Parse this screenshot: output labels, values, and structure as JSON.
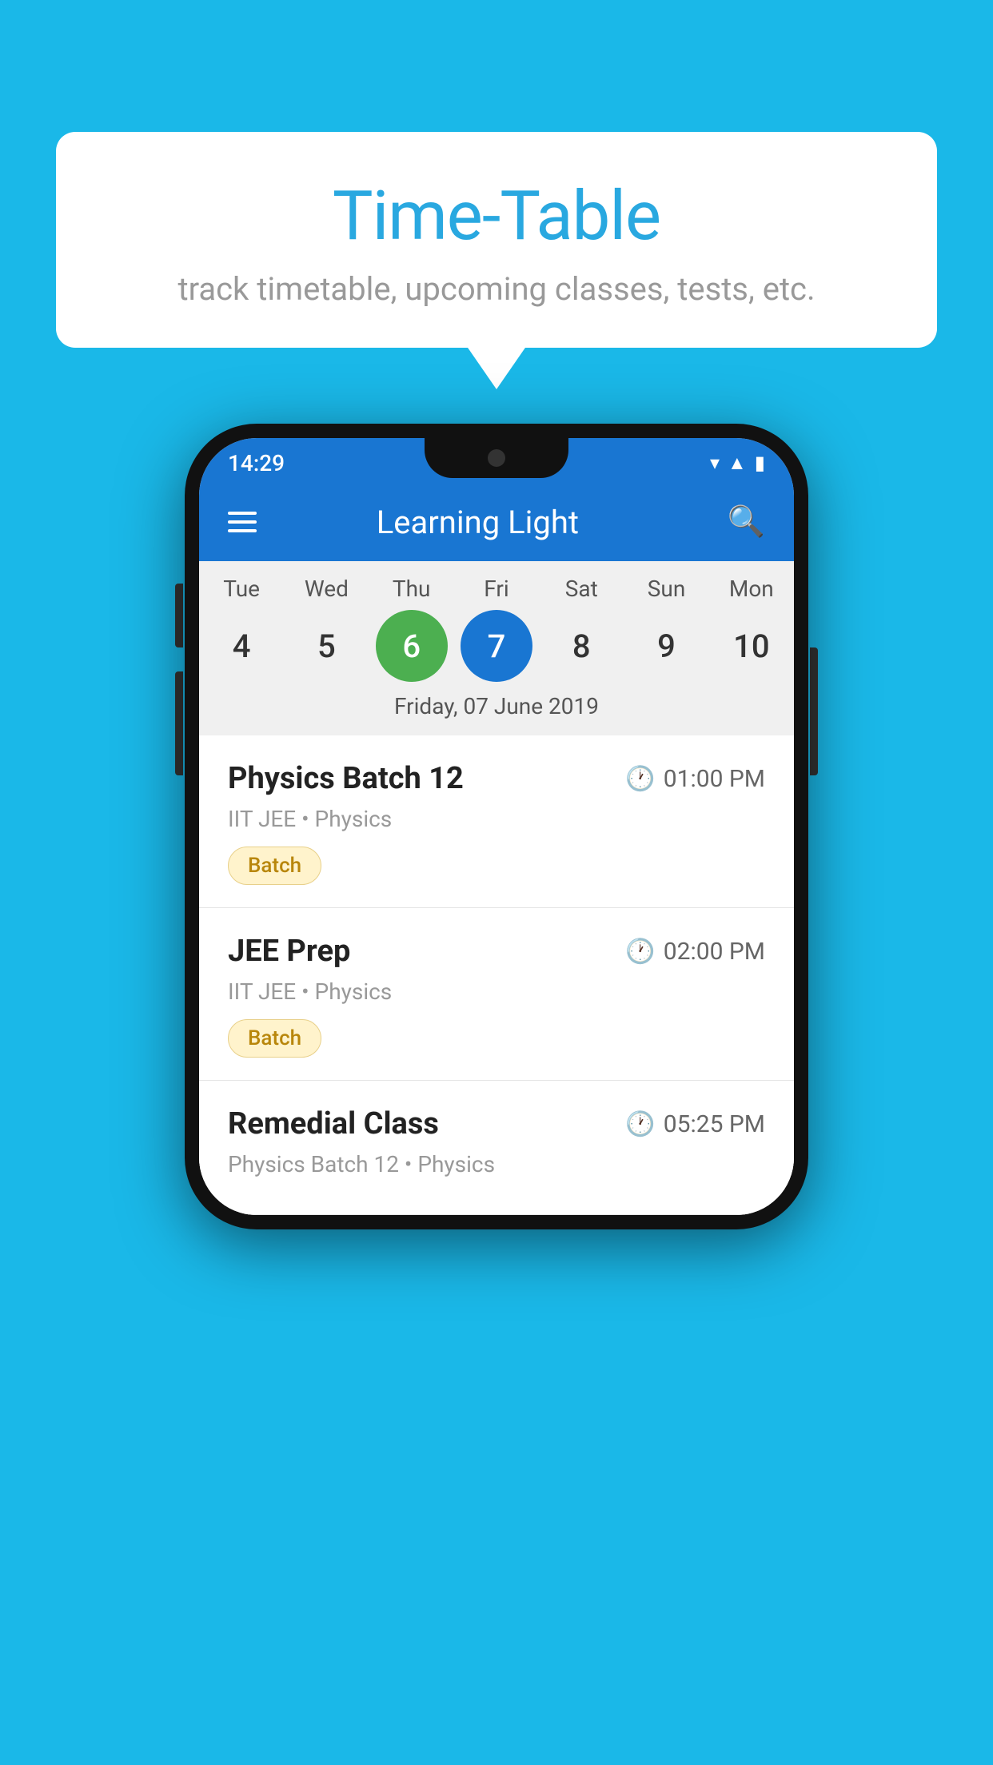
{
  "background": {
    "color": "#1ab8e8"
  },
  "bubble": {
    "title": "Time-Table",
    "subtitle": "track timetable, upcoming classes, tests, etc."
  },
  "phone": {
    "status_bar": {
      "time": "14:29"
    },
    "app_bar": {
      "title": "Learning Light"
    },
    "calendar": {
      "days": [
        "Tue",
        "Wed",
        "Thu",
        "Fri",
        "Sat",
        "Sun",
        "Mon"
      ],
      "dates": [
        "4",
        "5",
        "6",
        "7",
        "8",
        "9",
        "10"
      ],
      "today_index": 2,
      "selected_index": 3,
      "selected_label": "Friday, 07 June 2019"
    },
    "schedule": [
      {
        "title": "Physics Batch 12",
        "time": "01:00 PM",
        "subtitle": "IIT JEE • Physics",
        "tag": "Batch"
      },
      {
        "title": "JEE Prep",
        "time": "02:00 PM",
        "subtitle": "IIT JEE • Physics",
        "tag": "Batch"
      },
      {
        "title": "Remedial Class",
        "time": "05:25 PM",
        "subtitle": "Physics Batch 12 • Physics",
        "tag": ""
      }
    ]
  }
}
